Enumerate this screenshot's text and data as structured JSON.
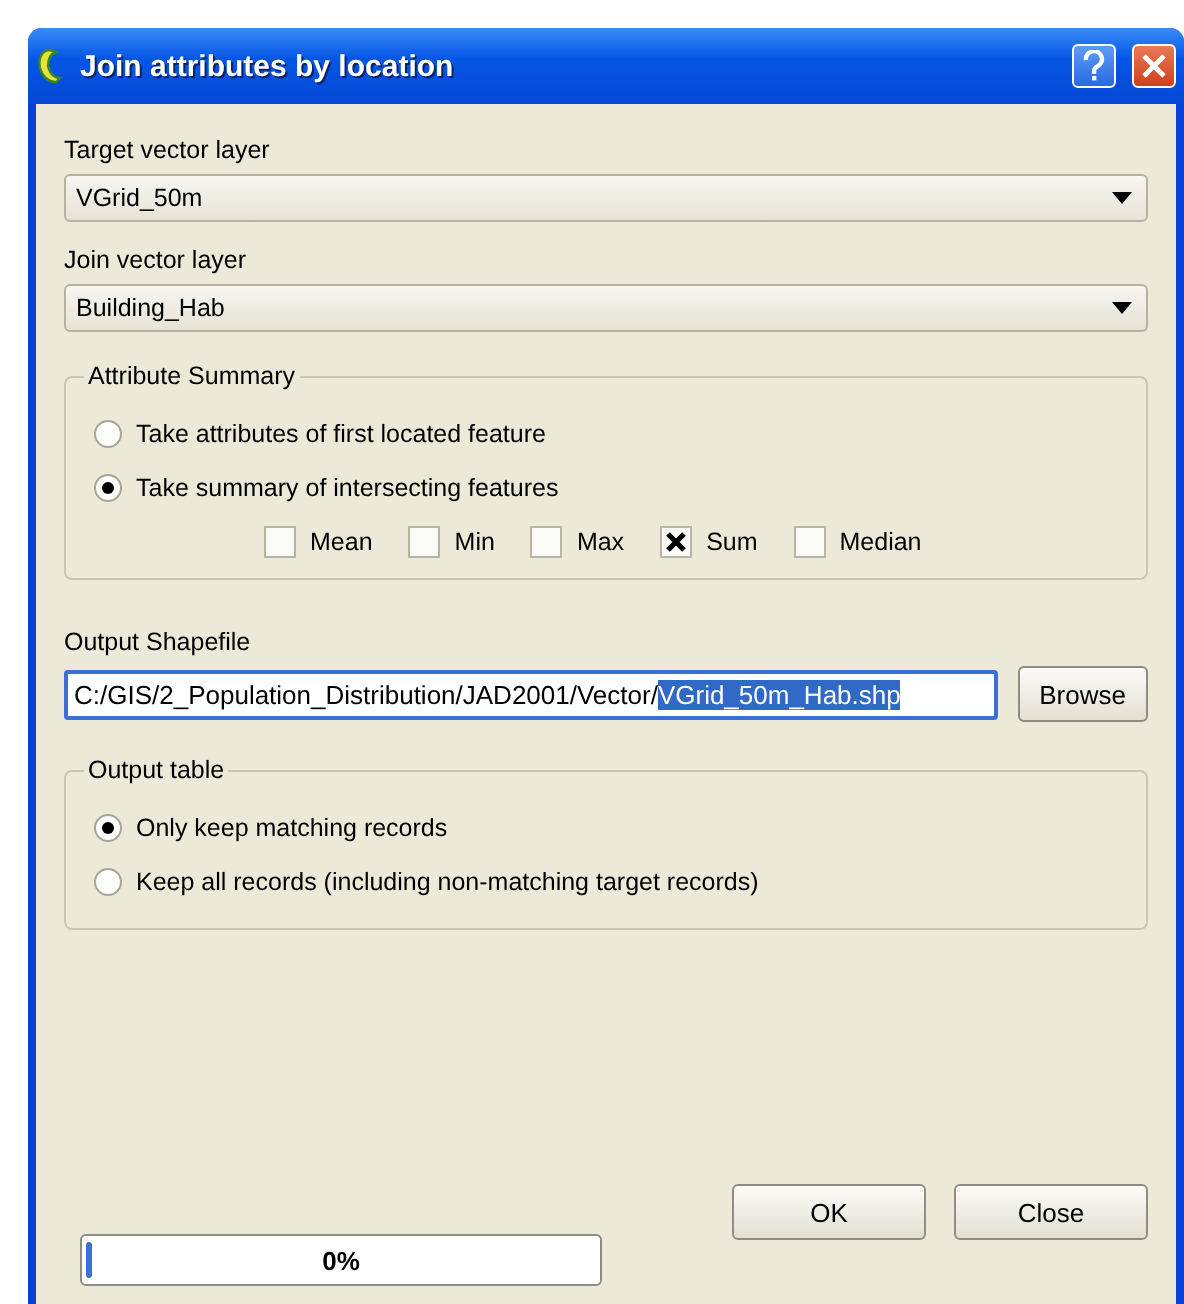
{
  "window": {
    "title": "Join attributes by location"
  },
  "target_layer": {
    "label": "Target vector layer",
    "value": "VGrid_50m"
  },
  "join_layer": {
    "label": "Join vector layer",
    "value": "Building_Hab"
  },
  "attribute_summary": {
    "title": "Attribute Summary",
    "options": [
      {
        "label": "Take attributes of first located feature",
        "selected": false
      },
      {
        "label": "Take summary of intersecting features",
        "selected": true
      }
    ],
    "statistics": [
      {
        "label": "Mean",
        "checked": false
      },
      {
        "label": "Min",
        "checked": false
      },
      {
        "label": "Max",
        "checked": false
      },
      {
        "label": "Sum",
        "checked": true
      },
      {
        "label": "Median",
        "checked": false
      }
    ]
  },
  "output_shapefile": {
    "label": "Output Shapefile",
    "text": "C:/GIS/2_Population_Distribution/JAD2001/Vector/",
    "selected_text": "VGrid_50m_Hab.shp",
    "browse": "Browse"
  },
  "output_table": {
    "title": "Output table",
    "options": [
      {
        "label": "Only keep matching records",
        "selected": true
      },
      {
        "label": "Keep all records (including non-matching target records)",
        "selected": false
      }
    ]
  },
  "buttons": [
    "OK",
    "Close"
  ],
  "progress": {
    "level": 0.01,
    "reading": "0%"
  }
}
